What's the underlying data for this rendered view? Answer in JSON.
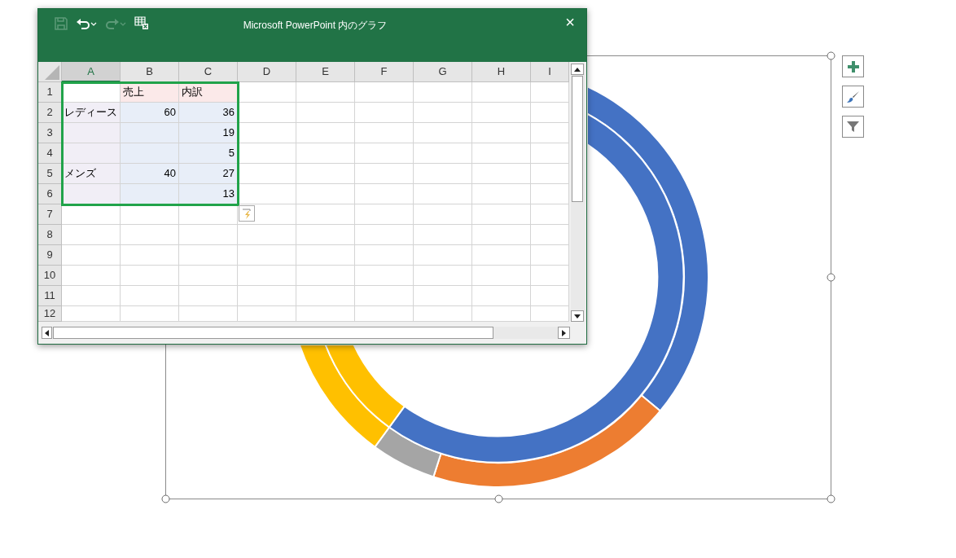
{
  "window": {
    "title": "Microsoft PowerPoint 内のグラフ",
    "close": "×"
  },
  "sheet": {
    "columns": [
      {
        "label": "A",
        "selected": true
      },
      {
        "label": "B",
        "selected": false
      },
      {
        "label": "C",
        "selected": false
      },
      {
        "label": "D",
        "selected": false
      },
      {
        "label": "E",
        "selected": false
      },
      {
        "label": "F",
        "selected": false
      },
      {
        "label": "G",
        "selected": false
      },
      {
        "label": "H",
        "selected": false
      },
      {
        "label": "I",
        "selected": false
      }
    ],
    "rows": [
      {
        "number": "1",
        "cells": [
          {
            "kind": "plain"
          },
          {
            "text": "売上",
            "kind": "series"
          },
          {
            "text": "内訳",
            "kind": "series"
          }
        ]
      },
      {
        "number": "2",
        "cells": [
          {
            "text": "レディース",
            "kind": "category"
          },
          {
            "text": "60",
            "kind": "value"
          },
          {
            "text": "36",
            "kind": "value"
          }
        ]
      },
      {
        "number": "3",
        "cells": [
          {
            "kind": "category"
          },
          {
            "kind": "value"
          },
          {
            "text": "19",
            "kind": "value"
          }
        ]
      },
      {
        "number": "4",
        "cells": [
          {
            "kind": "category"
          },
          {
            "kind": "value"
          },
          {
            "text": "5",
            "kind": "value"
          }
        ]
      },
      {
        "number": "5",
        "cells": [
          {
            "text": "メンズ",
            "kind": "category"
          },
          {
            "text": "40",
            "kind": "value"
          },
          {
            "text": "27",
            "kind": "value"
          }
        ]
      },
      {
        "number": "6",
        "cells": [
          {
            "kind": "category"
          },
          {
            "kind": "value"
          },
          {
            "text": "13",
            "kind": "value"
          }
        ]
      },
      {
        "number": "7",
        "cells": []
      },
      {
        "number": "8",
        "cells": []
      },
      {
        "number": "9",
        "cells": []
      },
      {
        "number": "10",
        "cells": []
      },
      {
        "number": "11",
        "cells": []
      },
      {
        "number": "12",
        "cells": []
      }
    ]
  }
}
